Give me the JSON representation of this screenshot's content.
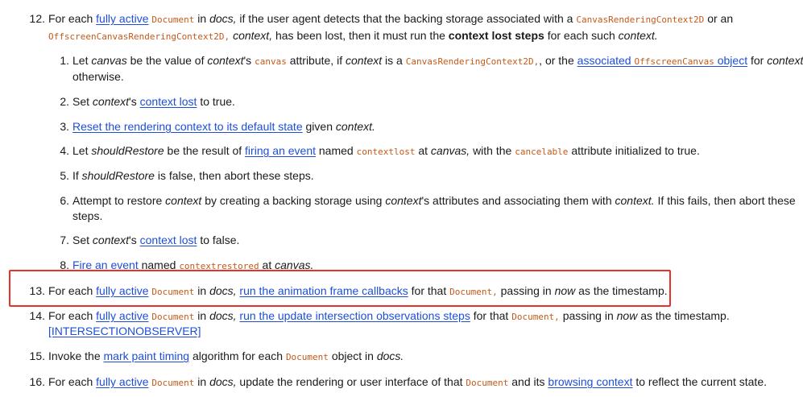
{
  "steps": {
    "s12": {
      "num": "12.",
      "t1": "For each",
      "a1": "fully active",
      "c1": "Document",
      "t2": "in",
      "e1": "docs,",
      "t3": "if the user agent detects that the backing storage associated with a",
      "c2": "CanvasRenderingContext2D",
      "t4": "or an",
      "c3": "OffscreenCanvasRenderingContext2D,",
      "e2": "context,",
      "t5": "has been lost, then it must run the",
      "b1": "context lost steps",
      "t6": "for each such",
      "e3": "context."
    },
    "sub1": {
      "num": "1.",
      "t1": "Let",
      "e1": "canvas",
      "t2": "be the value of",
      "e2": "context",
      "t3": "'s",
      "c1": "canvas",
      "t4": "attribute, if",
      "e3": "context",
      "t5": "is a",
      "c2": "CanvasRenderingContext2D,",
      "t6": ", or the",
      "a1": "associated",
      "ac1": "OffscreenCanvas",
      "a2": "object",
      "t7": "for",
      "e4": "context",
      "t8": "otherwise."
    },
    "sub2": {
      "num": "2.",
      "t1": "Set",
      "e1": "context",
      "t2": "'s",
      "a1": "context lost",
      "t3": "to true."
    },
    "sub3": {
      "num": "3.",
      "a1": "Reset the rendering context to its default state",
      "t1": "given",
      "e1": "context."
    },
    "sub4": {
      "num": "4.",
      "t1": "Let",
      "e1": "shouldRestore",
      "t2": "be the result of",
      "a1": "firing an event",
      "t3": "named",
      "c1": "contextlost",
      "t4": "at",
      "e2": "canvas,",
      "t5": "with the",
      "c2": "cancelable",
      "t6": "attribute initialized to true."
    },
    "sub5": {
      "num": "5.",
      "t1": "If",
      "e1": "shouldRestore",
      "t2": "is false, then abort these steps."
    },
    "sub6": {
      "num": "6.",
      "t1": "Attempt to restore",
      "e1": "context",
      "t2": "by creating a backing storage using",
      "e2": "context",
      "t3": "'s attributes and associating them with",
      "e3": "context.",
      "t4": "If this fails, then abort these",
      "t5": "steps."
    },
    "sub7": {
      "num": "7.",
      "t1": "Set",
      "e1": "context",
      "t2": "'s",
      "a1": "context lost",
      "t3": "to false."
    },
    "sub8": {
      "num": "8.",
      "a1": "Fire an event",
      "t1": "named",
      "c1": "contextrestored",
      "t2": "at",
      "e1": "canvas."
    },
    "s13": {
      "num": "13.",
      "t1": "For each",
      "a1": "fully active",
      "c1": "Document",
      "t2": "in",
      "e1": "docs,",
      "a2": "run the animation frame callbacks",
      "t3": "for that",
      "c2": "Document,",
      "t4": "passing in",
      "e2": "now",
      "t5": "as the timestamp."
    },
    "s14": {
      "num": "14.",
      "t1": "For each",
      "a1": "fully active",
      "c1": "Document",
      "t2": "in",
      "e1": "docs,",
      "a2": "run the update intersection observations steps",
      "t3": "for that",
      "c2": "Document,",
      "t4": "passing in",
      "e2": "now",
      "t5": "as the timestamp.",
      "a3": "[INTERSECTIONOBSERVER]"
    },
    "s15": {
      "num": "15.",
      "t1": "Invoke the",
      "a1": "mark paint timing",
      "t2": "algorithm for each",
      "c1": "Document",
      "t3": "object in",
      "e1": "docs."
    },
    "s16": {
      "num": "16.",
      "t1": "For each",
      "a1": "fully active",
      "c1": "Document",
      "t2": "in",
      "e1": "docs,",
      "t3": "update the rendering or user interface of that",
      "c2": "Document",
      "t4": "and its",
      "a2": "browsing context",
      "t5": "to reflect the current state."
    }
  }
}
